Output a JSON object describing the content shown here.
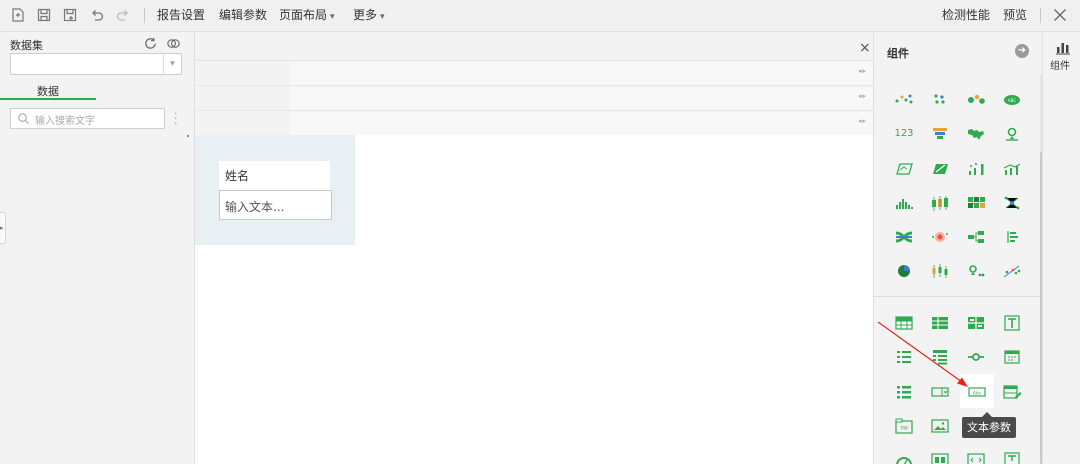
{
  "toolbar": {
    "report_settings": "报告设置",
    "edit_params": "编辑参数",
    "page_layout": "页面布局",
    "more": "更多",
    "check_performance": "检测性能",
    "preview": "预览"
  },
  "left_panel": {
    "title": "数据集",
    "tab_data": "数据",
    "search_placeholder": "输入搜索文字",
    "dataset_value": ""
  },
  "canvas": {
    "widget_label": "姓名",
    "widget_input": "输入文本..."
  },
  "components": {
    "title": "组件",
    "tooltip": "文本参数",
    "number_icon_text": "123"
  },
  "rail": {
    "components_label": "组件"
  },
  "colors": {
    "accent": "#2faa4f",
    "tooltip_bg": "#4a4a4a",
    "arrow": "#e8231f"
  }
}
